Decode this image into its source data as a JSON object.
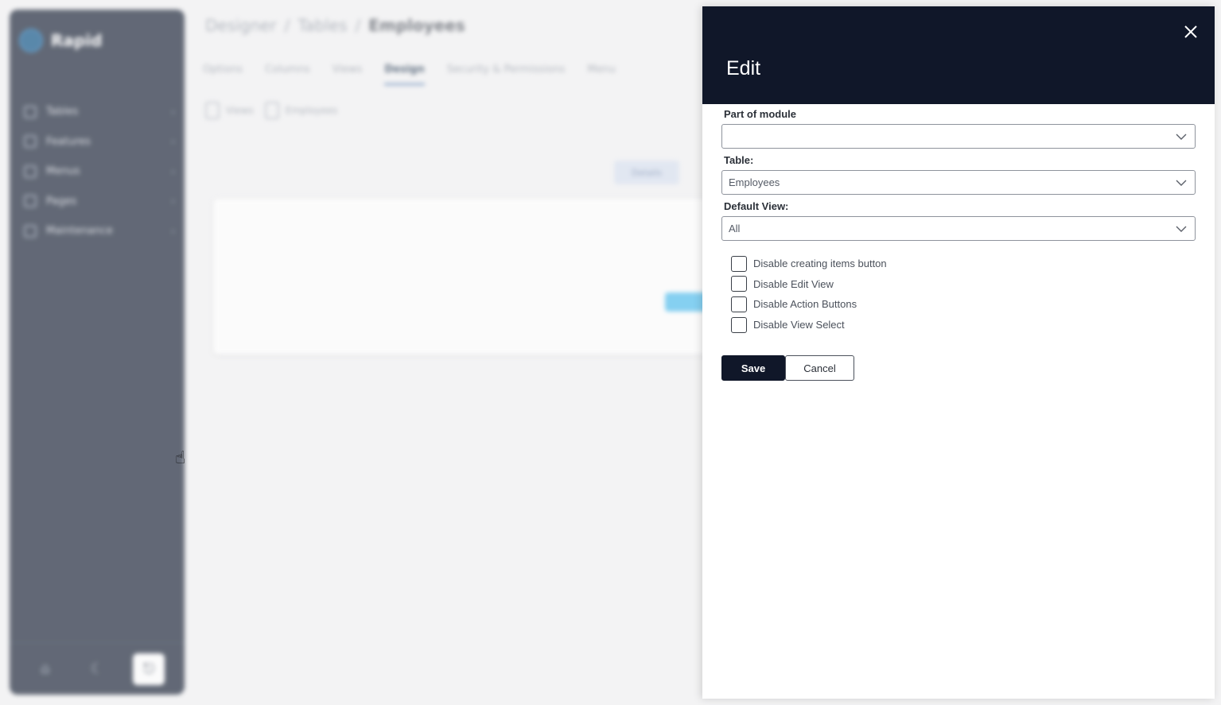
{
  "background": {
    "app_name": "Rapid",
    "sidebar": {
      "items": [
        {
          "label": "Tables",
          "icon": "table-icon"
        },
        {
          "label": "Features",
          "icon": "features-icon"
        },
        {
          "label": "Menus",
          "icon": "menu-icon"
        },
        {
          "label": "Pages",
          "icon": "page-icon"
        },
        {
          "label": "Maintenance",
          "icon": "maintenance-icon"
        }
      ],
      "bottom_icons": [
        "home-icon",
        "moon-icon",
        "logout-icon"
      ]
    },
    "breadcrumb": [
      "Designer",
      "Tables",
      "Employees"
    ],
    "tabs": [
      "Options",
      "Columns",
      "Views",
      "Design",
      "Security & Permissions",
      "Menu"
    ],
    "active_tab": "Design",
    "toolbar": {
      "tool1": "Views",
      "tool2": "Employees"
    },
    "pill_label": "Details"
  },
  "modal": {
    "title": "Edit",
    "fields": {
      "part_of_module": {
        "label": "Part of module",
        "value": ""
      },
      "table": {
        "label": "Table:",
        "value": "Employees"
      },
      "default_view": {
        "label": "Default View:",
        "value": "All"
      }
    },
    "checkboxes": [
      {
        "label": "Disable creating items button",
        "checked": false
      },
      {
        "label": "Disable Edit View",
        "checked": false
      },
      {
        "label": "Disable Action Buttons",
        "checked": false
      },
      {
        "label": "Disable View Select",
        "checked": false
      }
    ],
    "save_label": "Save",
    "cancel_label": "Cancel"
  },
  "colors": {
    "modal_header": "#101729",
    "sidebar_bg": "#2b3446",
    "save_bg": "#101729"
  }
}
